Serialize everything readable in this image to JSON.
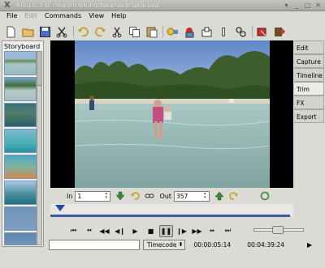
{
  "window": {
    "title": "Kino 0.7.0: /maurice/kino/fakarava/fakarava"
  },
  "menubar": [
    {
      "label": "File",
      "enabled": true
    },
    {
      "label": "Edit",
      "enabled": false
    },
    {
      "label": "Commands",
      "enabled": true
    },
    {
      "label": "View",
      "enabled": true
    },
    {
      "label": "Help",
      "enabled": true
    }
  ],
  "storyboard": {
    "label": "Storyboard"
  },
  "tabs": [
    "Edit",
    "Capture",
    "Timeline",
    "Trim",
    "FX",
    "Export"
  ],
  "trim": {
    "in_label": "In",
    "in_value": "1",
    "out_label": "Out",
    "out_value": "357"
  },
  "status": {
    "timecode_mode": "Timecode",
    "current_time": "00:00:05:14",
    "total_time": "00:04:39:24"
  },
  "colors": {
    "accent": "#3a5fa8",
    "window_bg": "#dcdad5"
  }
}
